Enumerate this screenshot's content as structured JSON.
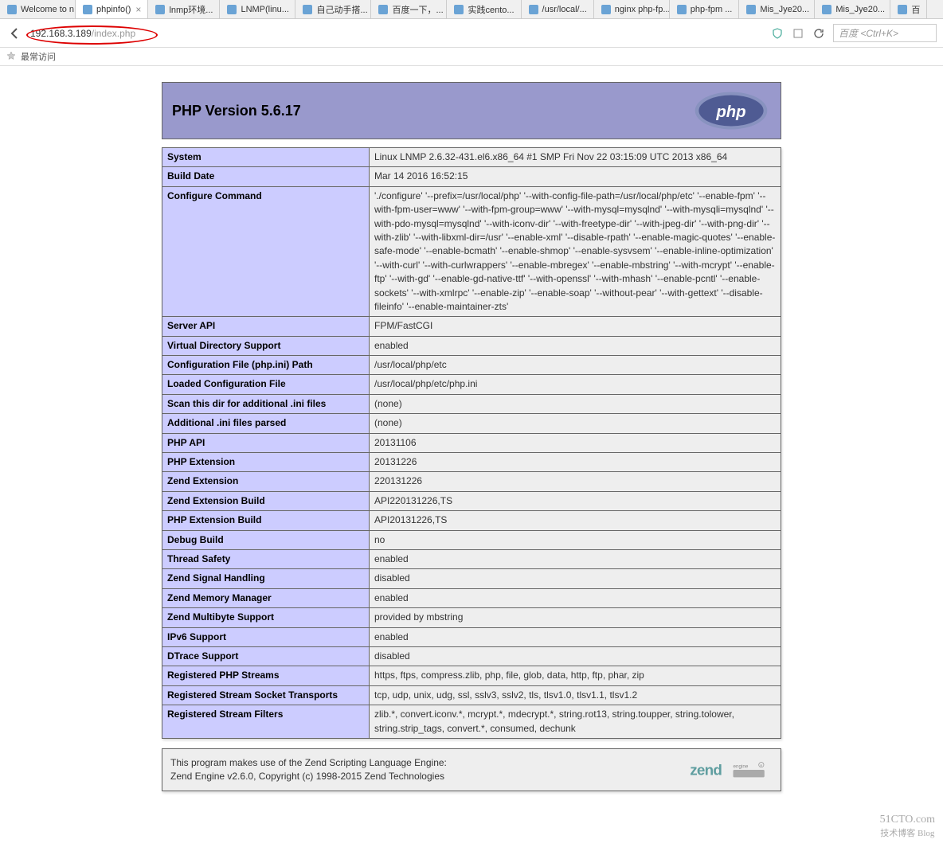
{
  "tabs": [
    {
      "label": "Welcome to n..."
    },
    {
      "label": "phpinfo()",
      "active": true
    },
    {
      "label": "lnmp环境..."
    },
    {
      "label": "LNMP(linu..."
    },
    {
      "label": "自己动手搭..."
    },
    {
      "label": "百度一下，..."
    },
    {
      "label": "实践cento..."
    },
    {
      "label": "/usr/local/..."
    },
    {
      "label": "nginx php-fp..."
    },
    {
      "label": "php-fpm ..."
    },
    {
      "label": "Mis_Jye20..."
    },
    {
      "label": "Mis_Jye20..."
    },
    {
      "label": "百"
    }
  ],
  "url": {
    "ip": "192.168.3.189",
    "path": "/index.php"
  },
  "bookmark_bar": {
    "label": "最常访问"
  },
  "search_placeholder": "百度 <Ctrl+K>",
  "php": {
    "version_label": "PHP Version 5.6.17",
    "rows": [
      {
        "k": "System",
        "v": "Linux LNMP 2.6.32-431.el6.x86_64 #1 SMP Fri Nov 22 03:15:09 UTC 2013 x86_64"
      },
      {
        "k": "Build Date",
        "v": "Mar 14 2016 16:52:15"
      },
      {
        "k": "Configure Command",
        "v": "'./configure' '--prefix=/usr/local/php' '--with-config-file-path=/usr/local/php/etc' '--enable-fpm' '--with-fpm-user=www' '--with-fpm-group=www' '--with-mysql=mysqlnd' '--with-mysqli=mysqlnd' '--with-pdo-mysql=mysqlnd' '--with-iconv-dir' '--with-freetype-dir' '--with-jpeg-dir' '--with-png-dir' '--with-zlib' '--with-libxml-dir=/usr' '--enable-xml' '--disable-rpath' '--enable-magic-quotes' '--enable-safe-mode' '--enable-bcmath' '--enable-shmop' '--enable-sysvsem' '--enable-inline-optimization' '--with-curl' '--with-curlwrappers' '--enable-mbregex' '--enable-mbstring' '--with-mcrypt' '--enable-ftp' '--with-gd' '--enable-gd-native-ttf' '--with-openssl' '--with-mhash' '--enable-pcntl' '--enable-sockets' '--with-xmlrpc' '--enable-zip' '--enable-soap' '--without-pear' '--with-gettext' '--disable-fileinfo' '--enable-maintainer-zts'"
      },
      {
        "k": "Server API",
        "v": "FPM/FastCGI"
      },
      {
        "k": "Virtual Directory Support",
        "v": "enabled"
      },
      {
        "k": "Configuration File (php.ini) Path",
        "v": "/usr/local/php/etc"
      },
      {
        "k": "Loaded Configuration File",
        "v": "/usr/local/php/etc/php.ini"
      },
      {
        "k": "Scan this dir for additional .ini files",
        "v": "(none)"
      },
      {
        "k": "Additional .ini files parsed",
        "v": "(none)"
      },
      {
        "k": "PHP API",
        "v": "20131106"
      },
      {
        "k": "PHP Extension",
        "v": "20131226"
      },
      {
        "k": "Zend Extension",
        "v": "220131226"
      },
      {
        "k": "Zend Extension Build",
        "v": "API220131226,TS"
      },
      {
        "k": "PHP Extension Build",
        "v": "API20131226,TS"
      },
      {
        "k": "Debug Build",
        "v": "no"
      },
      {
        "k": "Thread Safety",
        "v": "enabled"
      },
      {
        "k": "Zend Signal Handling",
        "v": "disabled"
      },
      {
        "k": "Zend Memory Manager",
        "v": "enabled"
      },
      {
        "k": "Zend Multibyte Support",
        "v": "provided by mbstring"
      },
      {
        "k": "IPv6 Support",
        "v": "enabled"
      },
      {
        "k": "DTrace Support",
        "v": "disabled"
      },
      {
        "k": "Registered PHP Streams",
        "v": "https, ftps, compress.zlib, php, file, glob, data, http, ftp, phar, zip"
      },
      {
        "k": "Registered Stream Socket Transports",
        "v": "tcp, udp, unix, udg, ssl, sslv3, sslv2, tls, tlsv1.0, tlsv1.1, tlsv1.2"
      },
      {
        "k": "Registered Stream Filters",
        "v": "zlib.*, convert.iconv.*, mcrypt.*, mdecrypt.*, string.rot13, string.toupper, string.tolower, string.strip_tags, convert.*, consumed, dechunk"
      }
    ],
    "zend": {
      "line1": "This program makes use of the Zend Scripting Language Engine:",
      "line2": "Zend Engine v2.6.0, Copyright (c) 1998-2015 Zend Technologies"
    }
  },
  "watermark": {
    "line1": "51CTO.com",
    "line2": "技术博客 Blog"
  }
}
